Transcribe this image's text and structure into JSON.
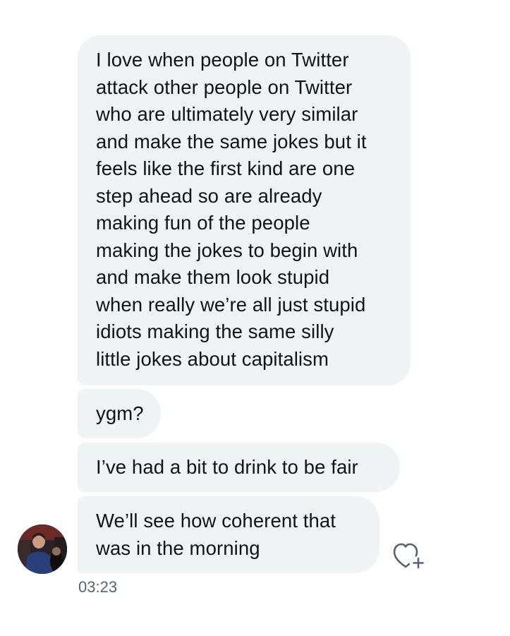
{
  "conversation": {
    "messages": [
      {
        "lines": [
          "I love when people on Twitter",
          "attack other people on Twitter",
          "who are ultimately very similar",
          "and make the same jokes but it",
          "feels like the first kind are one",
          "step ahead so are already",
          "making fun of the people",
          "making the jokes to begin with",
          "and make them look stupid",
          "when really we’re all just stupid",
          "idiots making the same silly",
          "little jokes about capitalism"
        ]
      },
      {
        "lines": [
          "ygm?"
        ]
      },
      {
        "lines": [
          "I’ve had a bit to drink to be fair"
        ]
      },
      {
        "lines": [
          "We’ll see how coherent that",
          "was in the morning"
        ]
      }
    ],
    "timestamp": "03:23",
    "reaction_icon": "heart-plus-icon",
    "avatar_icon": "user-avatar",
    "colors": {
      "bubble_background": "#eff3f4",
      "text": "#0f1419",
      "timestamp": "#536471",
      "icon": "#536471"
    }
  }
}
